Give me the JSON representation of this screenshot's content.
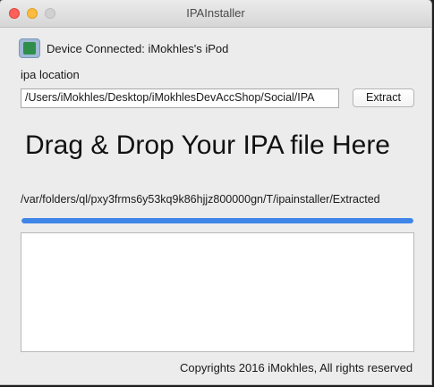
{
  "window": {
    "title": "IPAInstaller"
  },
  "device": {
    "status_label": "Device Connected: iMokhles's iPod",
    "status_color": "#2f8f4a"
  },
  "ipa": {
    "label": "ipa location",
    "path_value": "/Users/iMokhles/Desktop/iMokhlesDevAccShop/Social/IPA",
    "extract_label": "Extract"
  },
  "drop_zone": {
    "headline": "Drag & Drop Your IPA file Here"
  },
  "extraction": {
    "path_text": "/var/folders/ql/pxy3frms6y53kq9k86hjjz800000gn/T/ipainstaller/Extracted",
    "progress_fraction": 1.0,
    "progress_color": "#3f85e8"
  },
  "log": {
    "text": ""
  },
  "footer": {
    "copyright": "Copyrights 2016 iMokhles, All rights reserved"
  }
}
